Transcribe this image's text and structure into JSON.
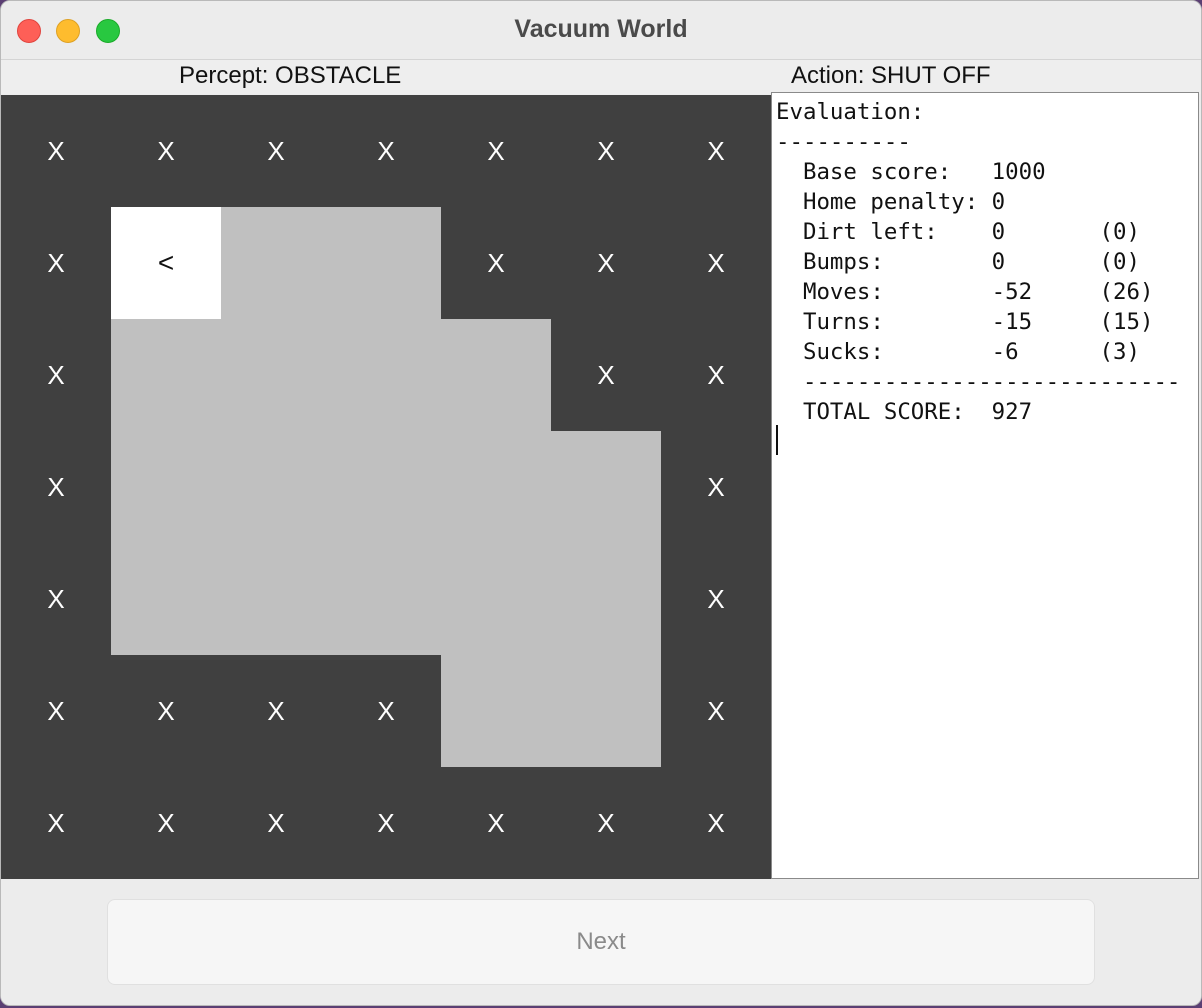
{
  "window": {
    "title": "Vacuum World"
  },
  "status": {
    "percept": "Percept: OBSTACLE",
    "action": "Action: SHUT OFF"
  },
  "grid": {
    "rows": 7,
    "cols": 7,
    "cells": [
      [
        "X",
        "X",
        "X",
        "X",
        "X",
        "X",
        "X"
      ],
      [
        "X",
        "<",
        "",
        "",
        "X",
        "X",
        "X"
      ],
      [
        "X",
        "",
        "",
        "",
        "",
        "X",
        "X"
      ],
      [
        "X",
        "",
        "",
        "",
        "",
        "",
        "X"
      ],
      [
        "X",
        "",
        "",
        "",
        "",
        "",
        "X"
      ],
      [
        "X",
        "X",
        "X",
        "X",
        "",
        "",
        "X"
      ],
      [
        "X",
        "X",
        "X",
        "X",
        "X",
        "X",
        "X"
      ]
    ],
    "legend": {
      "X": "wall",
      "<": "agent facing west",
      "": "clean floor"
    }
  },
  "evaluation": {
    "text": "Evaluation:\n----------\n  Base score:   1000\n  Home penalty: 0\n  Dirt left:    0       (0)\n  Bumps:        0       (0)\n  Moves:        -52     (26)\n  Turns:        -15     (15)\n  Sucks:        -6      (3)\n  ----------------------------\n  TOTAL SCORE:  927"
  },
  "buttons": {
    "next_label": "Next"
  },
  "colors": {
    "wall": "#404040",
    "floor": "#c0c0c0",
    "agent": "#ffffff",
    "wall_text": "#ffffff"
  }
}
